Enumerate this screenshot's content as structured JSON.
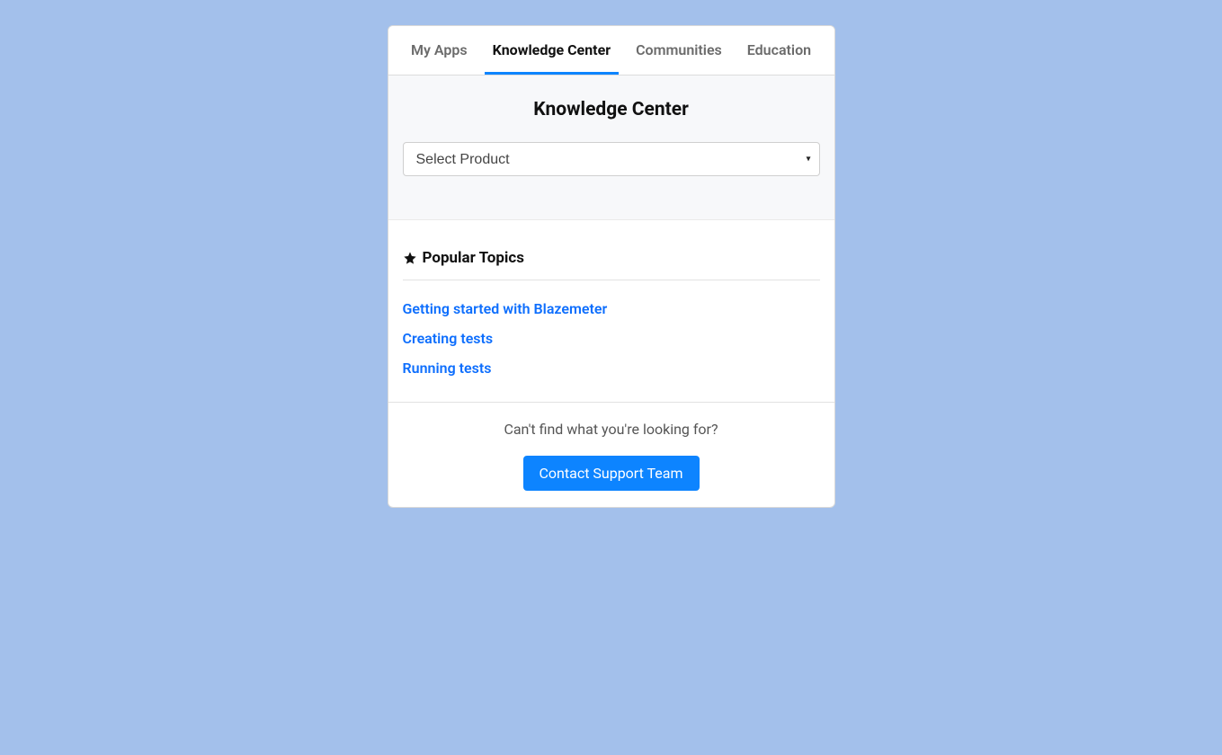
{
  "tabs": [
    {
      "label": "My Apps",
      "active": false
    },
    {
      "label": "Knowledge Center",
      "active": true
    },
    {
      "label": "Communities",
      "active": false
    },
    {
      "label": "Education",
      "active": false
    }
  ],
  "pageTitle": "Knowledge Center",
  "productSelect": {
    "placeholder": "Select Product"
  },
  "popularTopics": {
    "heading": "Popular Topics",
    "items": [
      "Getting started with Blazemeter",
      "Creating tests",
      "Running tests"
    ]
  },
  "footer": {
    "prompt": "Can't find what you're looking for?",
    "button": "Contact Support Team"
  }
}
